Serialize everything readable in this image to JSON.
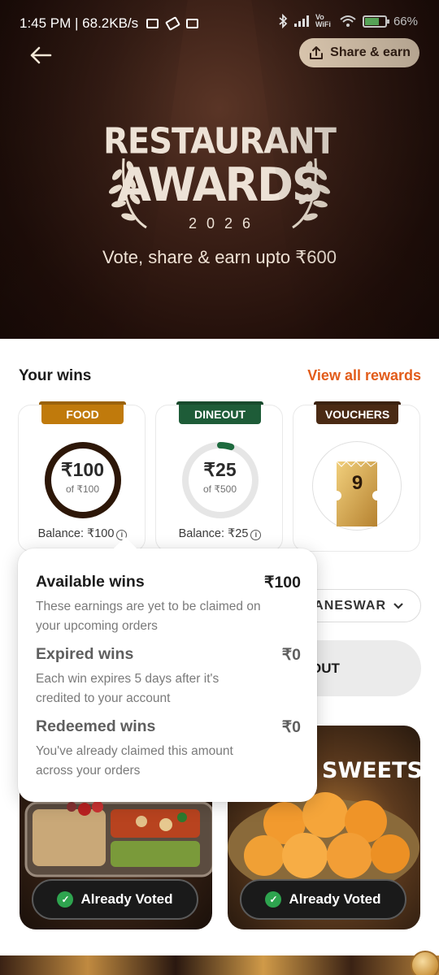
{
  "status_bar": {
    "time_network": "1:45 PM | 68.2KB/s",
    "wifi_label": "Vo WiFi",
    "battery": "66%"
  },
  "header": {
    "share_label": "Share & earn"
  },
  "hero": {
    "title_line1": "RESTAURANT",
    "title_line2": "AWARDS",
    "year": "2026",
    "tagline": "Vote, share & earn upto ₹600"
  },
  "wins": {
    "title": "Your wins",
    "view_all": "View all rewards",
    "cards": [
      {
        "tag": "FOOD",
        "tag_color": "#c07a0c",
        "amount": "₹100",
        "of": "of ₹100",
        "progress": 1.0,
        "ring_color": "#2d1708",
        "balance": "Balance: ₹100"
      },
      {
        "tag": "DINEOUT",
        "tag_color": "#1e5c38",
        "amount": "₹25",
        "of": "of ₹500",
        "progress": 0.05,
        "ring_color": "#1e6a3e",
        "balance": "Balance: ₹25"
      },
      {
        "tag": "VOUCHERS",
        "tag_color": "#4a2a14",
        "count": "9"
      }
    ]
  },
  "popup": {
    "rows": [
      {
        "title": "Available wins",
        "amount": "₹100",
        "desc": "These earnings are yet to be claimed on your upcoming orders"
      },
      {
        "title": "Expired wins",
        "amount": "₹0",
        "desc": "Each win expires 5 days after it's credited to your account"
      },
      {
        "title": "Redeemed wins",
        "amount": "₹0",
        "desc": "You've already claimed this amount across your orders"
      }
    ]
  },
  "background": {
    "city": "ANESWAR",
    "dineout_fragment": "OUT",
    "vote_cards": [
      {
        "title": "",
        "button": "Already Voted"
      },
      {
        "title": "SWEETS",
        "button": "Already Voted"
      }
    ]
  }
}
